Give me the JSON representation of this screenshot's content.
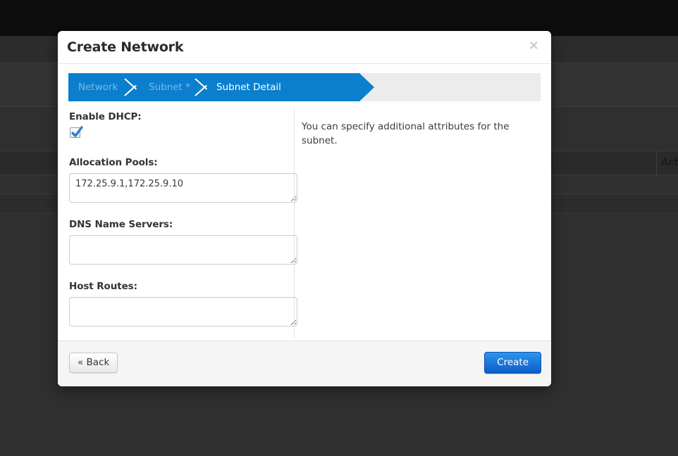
{
  "background": {
    "table_header_actions": "Act",
    "colors": {
      "topbar": "#0d0d0e",
      "page": "#2f2f2f",
      "row_divider": "#3a3a3a"
    }
  },
  "modal": {
    "title": "Create Network",
    "close_label": "×",
    "wizard": {
      "steps": [
        {
          "label": "Network",
          "state": "done"
        },
        {
          "label": "Subnet *",
          "state": "done"
        },
        {
          "label": "Subnet Detail",
          "state": "active"
        }
      ],
      "active_color": "#0b7fce",
      "track_color": "#ececec"
    },
    "form": {
      "dhcp": {
        "label": "Enable DHCP:",
        "checked": true
      },
      "allocation_pools": {
        "label": "Allocation Pools:",
        "value": "172.25.9.1,172.25.9.10",
        "placeholder": ""
      },
      "dns_name_servers": {
        "label": "DNS Name Servers:",
        "value": "",
        "placeholder": ""
      },
      "host_routes": {
        "label": "Host Routes:",
        "value": "",
        "placeholder": ""
      }
    },
    "help": {
      "text": "You can specify additional attributes for the subnet."
    },
    "footer": {
      "back_label": "« Back",
      "create_label": "Create",
      "create_color": "#0a5ec9"
    }
  }
}
